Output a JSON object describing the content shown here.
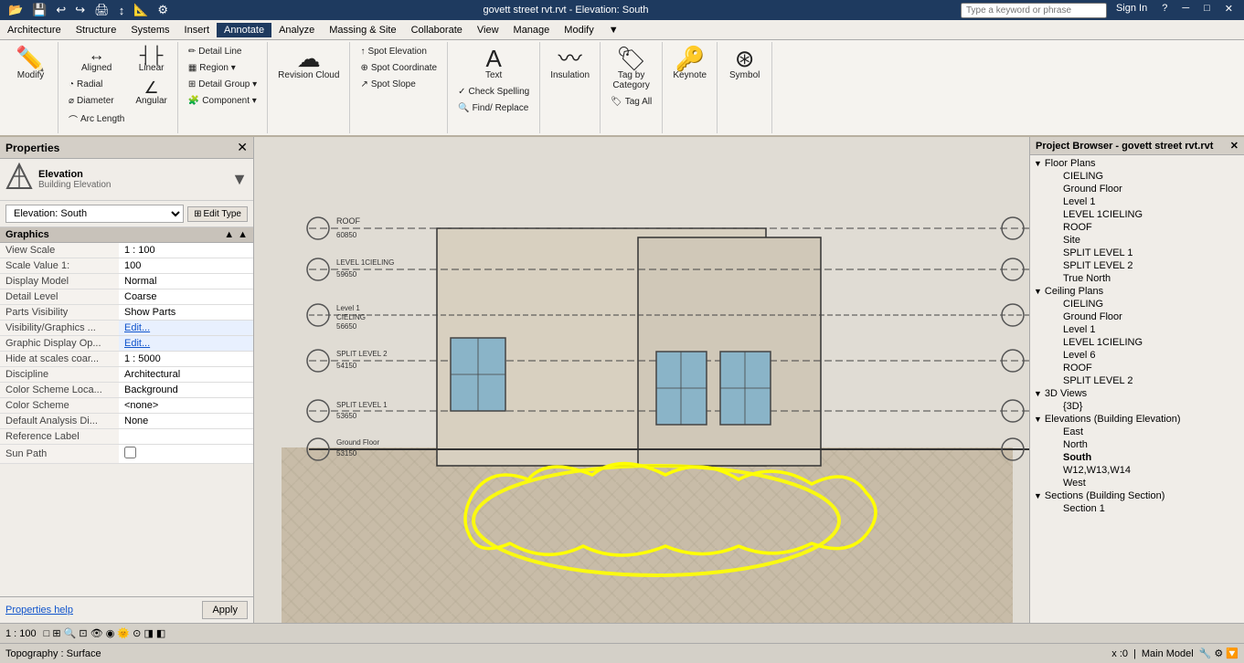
{
  "titleBar": {
    "fileName": "govett street rvt.rvt - Elevation: South",
    "searchPlaceholder": "Type a keyword or phrase",
    "signIn": "Sign In",
    "help": "?"
  },
  "menuBar": {
    "items": [
      "Architecture",
      "Structure",
      "Systems",
      "Insert",
      "Annotate",
      "Analyze",
      "Massing & Site",
      "Collaborate",
      "View",
      "Manage",
      "Modify"
    ]
  },
  "ribbon": {
    "activeTab": "Annotate",
    "tabs": [
      "Architecture",
      "Structure",
      "Systems",
      "Insert",
      "Annotate",
      "Analyze",
      "Massing & Site",
      "Collaborate",
      "View",
      "Manage",
      "Modify"
    ],
    "groups": {
      "dimension": {
        "label": "",
        "buttons": [
          "Aligned",
          "Linear",
          "Angular",
          "Radial",
          "Diameter",
          "Arc Length"
        ]
      },
      "detail": {
        "label": "",
        "buttons": [
          "Detail Line",
          "Region",
          "Detail Group",
          "Component"
        ]
      },
      "revisionCloud": {
        "label": "Revision Cloud"
      },
      "spotElevation": {
        "label": "Spot Elevation",
        "sub": [
          "Spot Coordinate",
          "Spot Slope"
        ]
      },
      "text": {
        "label": "Text",
        "sub": [
          "Check Spelling",
          "Find/ Replace"
        ]
      },
      "insulation": {
        "label": "Insulation"
      },
      "tag": {
        "label": "Tag",
        "sub": [
          "Tag by Category",
          "Tag All"
        ]
      },
      "keynote": {
        "label": "Keynote"
      },
      "symbol": {
        "label": "Symbol"
      }
    }
  },
  "properties": {
    "title": "Properties",
    "typeIcon": "⬆",
    "typeName": "Elevation",
    "typeSub": "Building Elevation",
    "elevationSelector": "Elevation: South",
    "editTypeLabel": "Edit Type",
    "graphicsHeader": "Graphics",
    "fields": [
      {
        "label": "View Scale",
        "value": "1 : 100"
      },
      {
        "label": "Scale Value  1:",
        "value": "100"
      },
      {
        "label": "Display Model",
        "value": "Normal"
      },
      {
        "label": "Detail Level",
        "value": "Coarse"
      },
      {
        "label": "Parts Visibility",
        "value": "Show Parts"
      },
      {
        "label": "Visibility/Graphics ...",
        "value": "Edit...",
        "editable": true
      },
      {
        "label": "Graphic Display Op...",
        "value": "Edit...",
        "editable": true
      },
      {
        "label": "Hide at scales coar...",
        "value": "1 : 5000"
      },
      {
        "label": "Discipline",
        "value": "Architectural"
      },
      {
        "label": "Color Scheme Loca...",
        "value": "Background"
      },
      {
        "label": "Color Scheme",
        "value": "<none>"
      },
      {
        "label": "Default Analysis Di...",
        "value": "None"
      },
      {
        "label": "Reference Label",
        "value": ""
      },
      {
        "label": "Sun Path",
        "value": "☐"
      }
    ],
    "helpLink": "Properties help",
    "applyButton": "Apply"
  },
  "elevation": {
    "levels": [
      {
        "name": "ROOF",
        "elev": "60850",
        "leftX": 440,
        "rightX": 1000
      },
      {
        "name": "LEVEL 1CIELING",
        "elev": "59650",
        "leftX": 430,
        "rightX": 900
      },
      {
        "name": "Level 1 CIELING",
        "elev": "56650",
        "leftX": 430,
        "rightX": 980
      },
      {
        "name": "SPLIT LEVEL 2",
        "elev": "54150",
        "leftX": 430,
        "rightX": 980
      },
      {
        "name": "SPLIT LEVEL 1",
        "elev": "53650",
        "leftX": 430,
        "rightX": 980
      },
      {
        "name": "Ground Floor",
        "elev": "53150",
        "leftX": 430,
        "rightX": 980
      }
    ]
  },
  "projectBrowser": {
    "title": "Project Browser - govett street rvt.rvt",
    "tree": [
      {
        "name": "Floor Plans",
        "expanded": true,
        "items": [
          "CIELING",
          "Ground Floor",
          "Level 1",
          "LEVEL 1CIELING",
          "ROOF",
          "Site",
          "SPLIT LEVEL 1",
          "SPLIT LEVEL 2",
          "True North"
        ]
      },
      {
        "name": "Ceiling Plans",
        "expanded": true,
        "items": [
          "CIELING",
          "Ground Floor",
          "Level 1",
          "LEVEL 1CIELING",
          "Level 6",
          "ROOF",
          "SPLIT LEVEL 2"
        ]
      },
      {
        "name": "3D Views",
        "expanded": true,
        "items": [
          "{3D}"
        ]
      },
      {
        "name": "Elevations (Building Elevation)",
        "expanded": true,
        "items": [
          "East",
          "North",
          "South",
          "W12,W13,W14",
          "West"
        ]
      },
      {
        "name": "Sections (Building Section)",
        "expanded": true,
        "items": [
          "Section 1"
        ]
      }
    ]
  },
  "viewBar": {
    "scale": "1 : 100"
  },
  "statusBar": {
    "text": "Topography : Surface",
    "model": "Main Model",
    "coords": "x :0"
  }
}
